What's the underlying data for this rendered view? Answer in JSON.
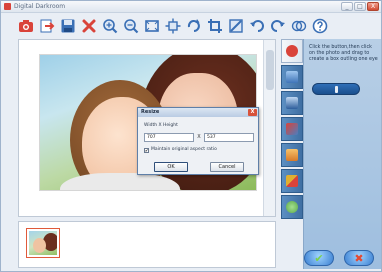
{
  "window": {
    "title": "Digital Darkroom",
    "minimize_label": "_",
    "maximize_label": "□",
    "close_label": "X"
  },
  "toolbar": {
    "items": [
      {
        "name": "camera-icon",
        "color": "#d9433a"
      },
      {
        "name": "import-icon",
        "color": "#d9433a"
      },
      {
        "name": "save-icon",
        "color": "#3a6fb5"
      },
      {
        "name": "delete-icon",
        "color": "#d9433a"
      },
      {
        "name": "zoom-in-icon",
        "color": "#3a6fb5"
      },
      {
        "name": "zoom-out-icon",
        "color": "#3a6fb5"
      },
      {
        "name": "fit-icon",
        "color": "#3a6fb5"
      },
      {
        "name": "resize-icon",
        "color": "#3a6fb5"
      },
      {
        "name": "rotate-icon",
        "color": "#3a6fb5"
      },
      {
        "name": "crop-icon",
        "color": "#3a6fb5"
      },
      {
        "name": "straighten-icon",
        "color": "#3a6fb5"
      },
      {
        "name": "undo-icon",
        "color": "#3a6fb5"
      },
      {
        "name": "redo-icon",
        "color": "#3a6fb5"
      },
      {
        "name": "compare-icon",
        "color": "#3a6fb5"
      },
      {
        "name": "help-icon",
        "color": "#3a6fb5"
      }
    ]
  },
  "dialog": {
    "title": "Resize",
    "close_label": "X",
    "dimension_label": "Width X Height",
    "width_value": "707",
    "separator": "X",
    "height_value": "537",
    "maintain_aspect_label": "Maintain original aspect ratio",
    "maintain_aspect_checked": true,
    "ok_label": "OK",
    "cancel_label": "Cancel"
  },
  "side_panel": {
    "help_text": "Click the button,then click on the photo and drag to create a box outling one eye",
    "tabs": [
      {
        "name": "red-eye-tab-icon",
        "color": "#d9433a"
      },
      {
        "name": "enhance-tab-icon",
        "color": "#3f74b8"
      },
      {
        "name": "adjust-tab-icon",
        "color": "#2e5e9c"
      },
      {
        "name": "color-tab-icon",
        "color": "#4a7ec0"
      },
      {
        "name": "effects-tab-icon",
        "color": "#d67a2a"
      },
      {
        "name": "frames-tab-icon",
        "color": "#e0b030"
      },
      {
        "name": "share-tab-icon",
        "color": "#5aa84a"
      }
    ],
    "ok_symbol": "✔",
    "cancel_symbol": "✖"
  }
}
